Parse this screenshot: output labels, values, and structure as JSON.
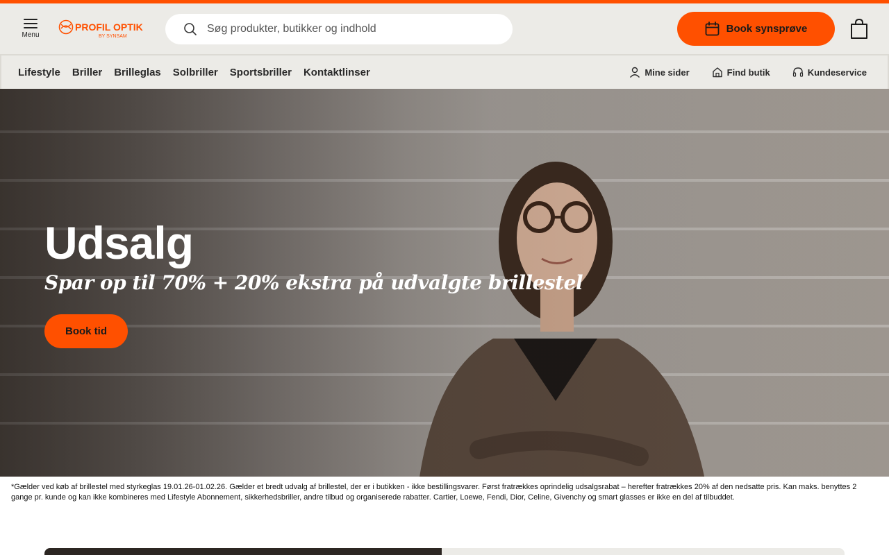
{
  "colors": {
    "brand": "#ff5000",
    "header_bg": "#ecebe7"
  },
  "header": {
    "menu_label": "Menu",
    "logo_text": "PROFIL OPTIK",
    "logo_subtext": "BY SYNSAM",
    "search_placeholder": "Søg produkter, butikker og indhold",
    "book_button": "Book synsprøve"
  },
  "nav": {
    "left": [
      {
        "label": "Lifestyle"
      },
      {
        "label": "Briller"
      },
      {
        "label": "Brilleglas"
      },
      {
        "label": "Solbriller"
      },
      {
        "label": "Sportsbriller"
      },
      {
        "label": "Kontaktlinser"
      }
    ],
    "right": [
      {
        "label": "Mine sider",
        "icon": "user-icon"
      },
      {
        "label": "Find butik",
        "icon": "store-icon"
      },
      {
        "label": "Kundeservice",
        "icon": "headset-icon"
      }
    ]
  },
  "hero": {
    "title": "Udsalg",
    "subtitle": "Spar op til 70% + 20% ekstra på udvalgte brillestel",
    "cta": "Book tid"
  },
  "disclaimer": "*Gælder ved køb af brillestel med styrkeglas 19.01.26-01.02.26. Gælder et bredt udvalg af brillestel, der er i butikken - ikke bestillingsvarer. Først fratrækkes oprindelig udsalgsrabat – herefter fratrækkes 20% af den nedsatte pris. Kan maks. benyttes 2 gange pr. kunde og kan ikke kombineres med Lifestyle Abonnement, sikkerhedsbriller, andre tilbud og organiserede rabatter. Cartier, Loewe, Fendi, Dior, Celine, Givenchy og smart glasses er ikke en del af tilbuddet."
}
